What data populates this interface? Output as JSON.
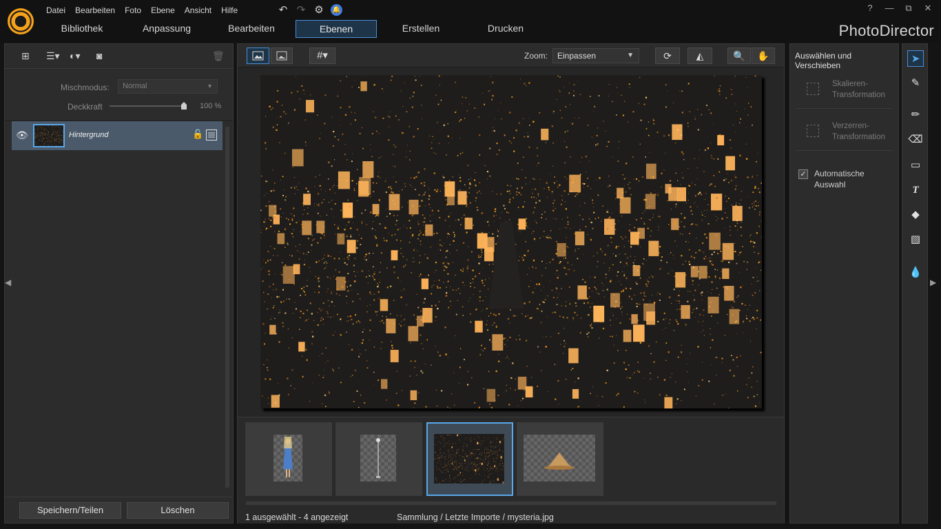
{
  "app": {
    "brand": "PhotoDirector"
  },
  "menu": [
    "Datei",
    "Bearbeiten",
    "Foto",
    "Ebene",
    "Ansicht",
    "Hilfe"
  ],
  "window_controls": {
    "help": "?",
    "minimize": "—",
    "restore": "⧉",
    "close": "✕"
  },
  "tabs": [
    {
      "label": "Bibliothek",
      "active": false
    },
    {
      "label": "Anpassung",
      "active": false
    },
    {
      "label": "Bearbeiten",
      "active": false
    },
    {
      "label": "Ebenen",
      "active": true
    },
    {
      "label": "Erstellen",
      "active": false
    },
    {
      "label": "Drucken",
      "active": false
    }
  ],
  "layers_panel": {
    "blend_label": "Mischmodus:",
    "blend_value": "Normal",
    "opacity_label": "Deckkraft",
    "opacity_value": "100 %",
    "opacity_level": 1.0,
    "layers": [
      {
        "name": "Hintergrund",
        "visible": true,
        "locked": true
      }
    ],
    "save_button": "Speichern/Teilen",
    "delete_button": "Löschen"
  },
  "canvas_toolbar": {
    "zoom_label": "Zoom:",
    "zoom_value": "Einpassen"
  },
  "filmstrip": {
    "items": [
      {
        "name": "girl-figure",
        "selected": false
      },
      {
        "name": "lamp-post",
        "selected": false
      },
      {
        "name": "mysteria",
        "selected": true
      },
      {
        "name": "straw-hat",
        "selected": false
      }
    ],
    "status_left": "1 ausgewählt - 4 angezeigt",
    "status_right": "Sammlung / Letzte Importe / mysteria.jpg"
  },
  "tool_panel": {
    "title": "Auswählen und Verschieben",
    "scale_label": "Skalieren-\nTransformation",
    "skew_label": "Verzerren-\nTransformation",
    "auto_select_label": "Automatische\nAuswahl",
    "auto_select_checked": true
  },
  "colors": {
    "accent": "#4a90d8",
    "lantern": "#f5a21b",
    "panel": "#2c2c2c"
  }
}
